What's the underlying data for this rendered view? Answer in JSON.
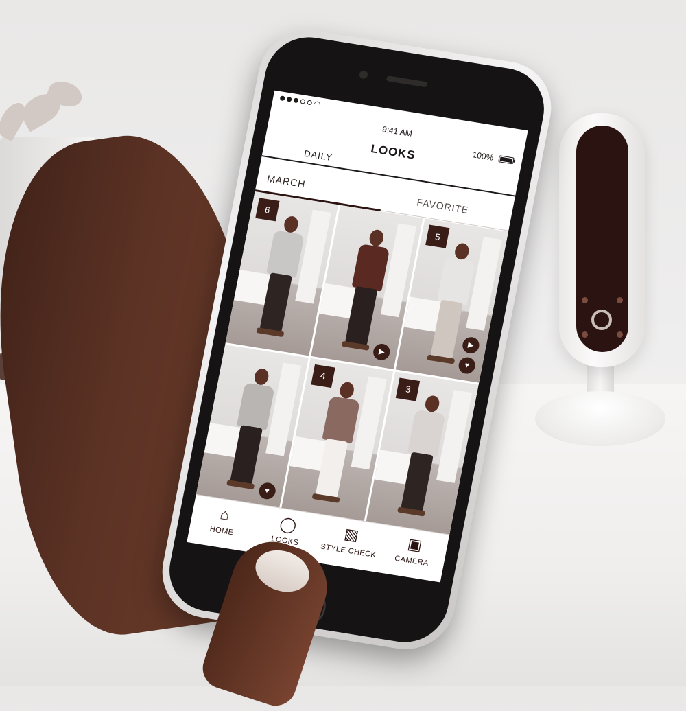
{
  "status_bar": {
    "time": "9:41 AM",
    "battery": "100%"
  },
  "app": {
    "title": "LOOKS",
    "top_tab": "DAILY",
    "sub_tabs": [
      {
        "label": "MARCH",
        "selected": true
      },
      {
        "label": "FAVORITE",
        "selected": false
      }
    ]
  },
  "looks": [
    {
      "badge": "6",
      "icons": [],
      "torso_color": "#c9c7c6",
      "legs_color": "#2e2422"
    },
    {
      "badge": "",
      "icons": [
        "play-icon"
      ],
      "torso_color": "#5a2a22",
      "legs_color": "#2a2020"
    },
    {
      "badge": "5",
      "icons": [
        "play-icon",
        "heart-icon"
      ],
      "torso_color": "#e7e5e3",
      "legs_color": "#cfc6c0"
    },
    {
      "badge": "",
      "icons": [
        "heart-icon"
      ],
      "torso_color": "#b9b5b3",
      "legs_color": "#2a2020"
    },
    {
      "badge": "4",
      "icons": [],
      "torso_color": "#8a6a60",
      "legs_color": "#f2efed"
    },
    {
      "badge": "3",
      "icons": [],
      "torso_color": "#d9d4d1",
      "legs_color": "#2e2422"
    }
  ],
  "bottom_nav": [
    {
      "label": "HOME",
      "icon": "home-icon"
    },
    {
      "label": "LOOKS",
      "icon": "person-icon"
    },
    {
      "label": "STYLE CHECK",
      "icon": "photos-icon"
    },
    {
      "label": "CAMERA",
      "icon": "camera-icon"
    }
  ],
  "colors": {
    "accent": "#3b1d17",
    "skin": "#5b3224",
    "device_face": "#2a1310"
  }
}
